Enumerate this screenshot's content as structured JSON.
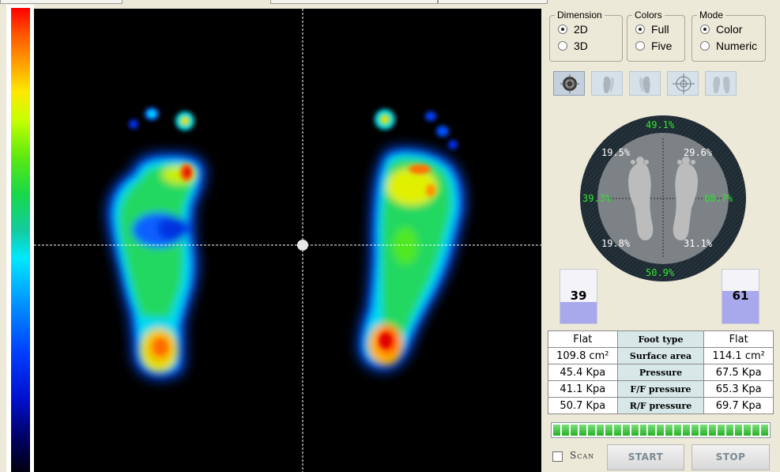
{
  "window": {
    "tabs": [
      "",
      "",
      ""
    ]
  },
  "color_scale": {
    "name": "pressure-color-scale"
  },
  "pressure_map": {
    "description_colors": {
      "background": "#000000",
      "crosshair": "#ffffff"
    }
  },
  "controls": {
    "dimension": {
      "legend": "Dimension",
      "options": [
        "2D",
        "3D"
      ],
      "selected": "2D"
    },
    "colors": {
      "legend": "Colors",
      "options": [
        "Full",
        "Five"
      ],
      "selected": "Full"
    },
    "mode": {
      "legend": "Mode",
      "options": [
        "Color",
        "Numeric"
      ],
      "selected": "Color"
    },
    "toolbar": [
      "target-foot-icon",
      "left-foot-icon",
      "right-foot-icon",
      "crosshair-icon",
      "both-feet-icon"
    ]
  },
  "balance": {
    "front": "49.1%",
    "rear": "50.9%",
    "left": "39.3%",
    "right": "60.7%",
    "left_front": "19.5%",
    "right_front": "29.6%",
    "left_rear": "19.8%",
    "right_rear": "31.1%"
  },
  "gauges": {
    "left": {
      "value": "39",
      "fraction": 0.39
    },
    "right": {
      "value": "61",
      "fraction": 0.61
    }
  },
  "stats": {
    "rows": [
      {
        "left": "Flat",
        "label": "Foot type",
        "right": "Flat"
      },
      {
        "left": "109.8 cm²",
        "label": "Surface area",
        "right": "114.1 cm²"
      },
      {
        "left": "45.4 Kpa",
        "label": "Pressure",
        "right": "67.5 Kpa"
      },
      {
        "left": "41.1 Kpa",
        "label": "F/F pressure",
        "right": "65.3 Kpa"
      },
      {
        "left": "50.7 Kpa",
        "label": "R/F pressure",
        "right": "69.7 Kpa"
      }
    ]
  },
  "progress": {
    "fraction": 1.0
  },
  "footer": {
    "scan_label": "Scan",
    "start_label": "START",
    "stop_label": "STOP"
  }
}
